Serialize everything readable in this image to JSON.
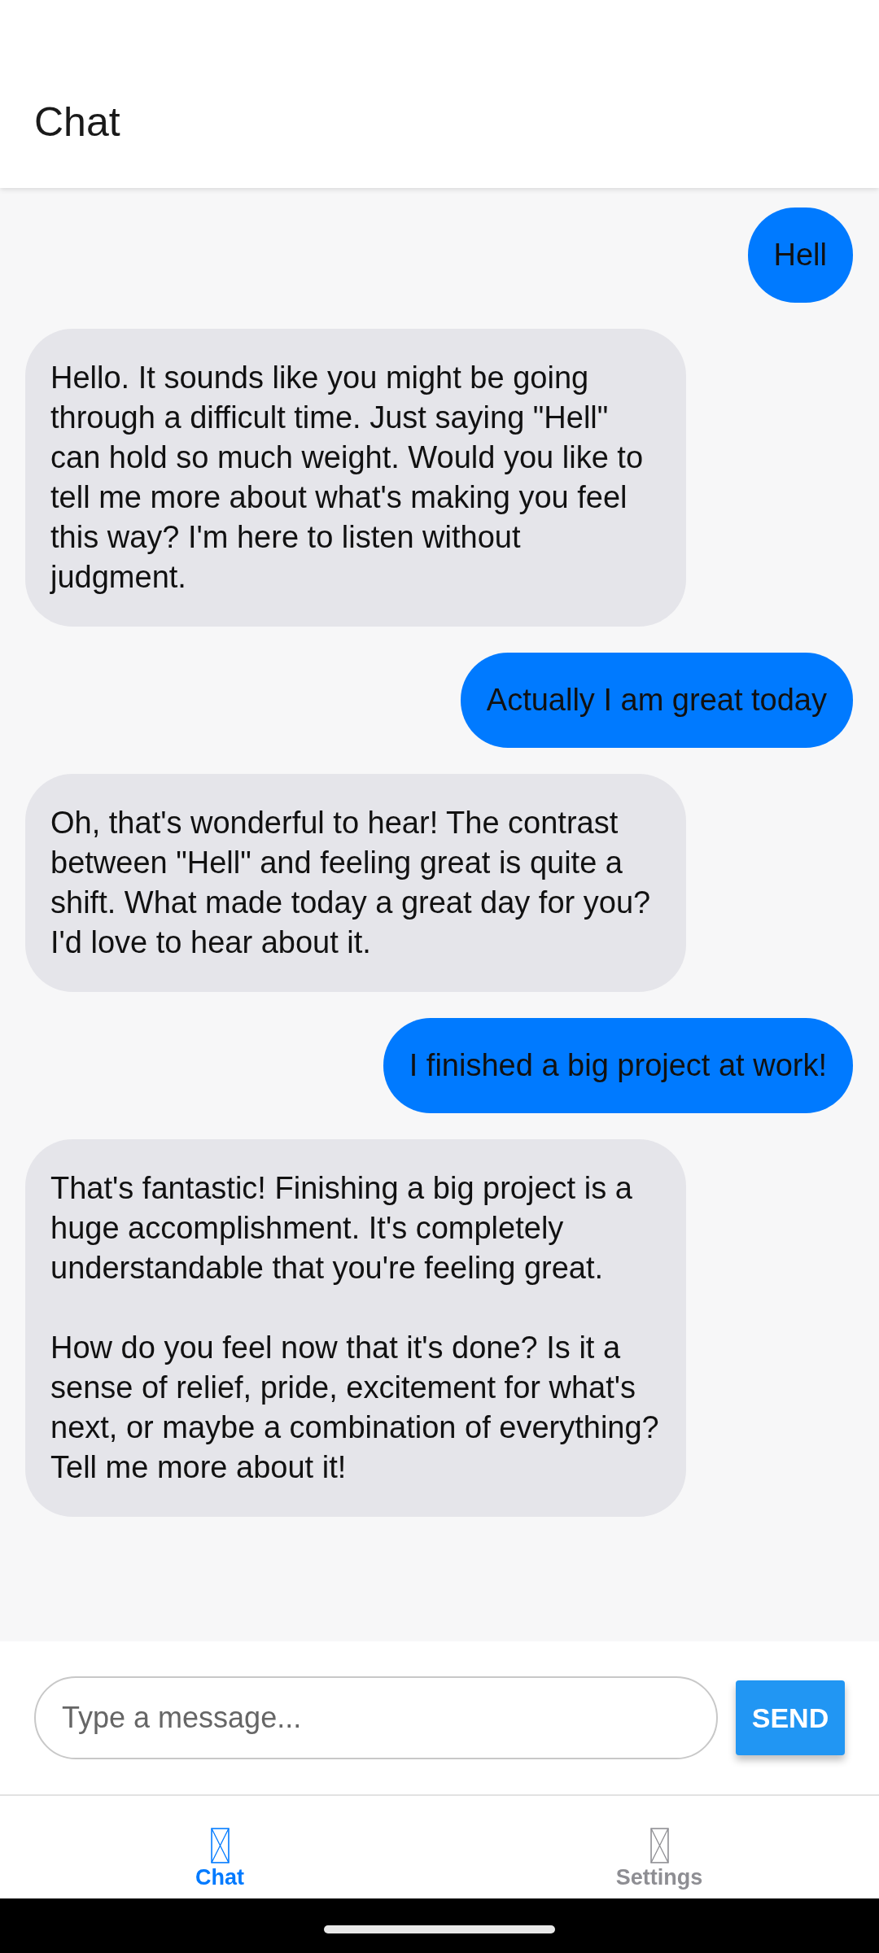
{
  "header": {
    "title": "Chat"
  },
  "messages": [
    {
      "kind": "user",
      "text": "Hell"
    },
    {
      "kind": "bot",
      "text": "Hello. It sounds like you might be going through a difficult time. Just saying \"Hell\" can hold so much weight. Would you like to tell me more about what's making you feel this way? I'm here to listen without judgment."
    },
    {
      "kind": "user",
      "text": "Actually I am great today"
    },
    {
      "kind": "bot",
      "text": "Oh, that's wonderful to hear! The contrast between \"Hell\" and feeling great is quite a shift. What made today a great day for you? I'd love to hear about it."
    },
    {
      "kind": "user",
      "text": "I finished a big project at work!"
    },
    {
      "kind": "bot",
      "text": "That's fantastic! Finishing a big project is a huge accomplishment. It's completely understandable that you're feeling great.\n\nHow do you feel now that it's done? Is it a sense of relief, pride, excitement for what's next, or maybe a combination of everything? Tell me more about it!"
    }
  ],
  "composer": {
    "placeholder": "Type a message...",
    "send": "SEND"
  },
  "tabs": [
    {
      "label": "Chat",
      "selected": true
    },
    {
      "label": "Settings",
      "selected": false
    }
  ]
}
